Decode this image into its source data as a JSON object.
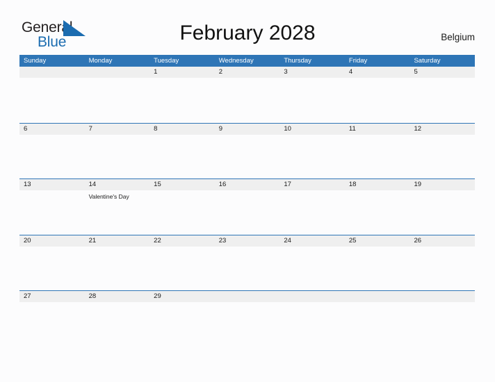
{
  "brand": {
    "name_part1": "General",
    "name_part2": "Blue",
    "flag_icon": "blue-triangle-flag-icon",
    "accent_color": "#1b6cb0"
  },
  "header": {
    "title": "February 2028",
    "country": "Belgium"
  },
  "theme": {
    "header_blue": "#2e75b6",
    "band_gray": "#efefef",
    "page_background": "#fcfcfd",
    "text_color": "#1a1a1a"
  },
  "calendar": {
    "month": "February",
    "year": "2028",
    "weekday_headers": [
      "Sunday",
      "Monday",
      "Tuesday",
      "Wednesday",
      "Thursday",
      "Friday",
      "Saturday"
    ],
    "weeks": [
      [
        {
          "date": "",
          "events": []
        },
        {
          "date": "",
          "events": []
        },
        {
          "date": "1",
          "events": []
        },
        {
          "date": "2",
          "events": []
        },
        {
          "date": "3",
          "events": []
        },
        {
          "date": "4",
          "events": []
        },
        {
          "date": "5",
          "events": []
        }
      ],
      [
        {
          "date": "6",
          "events": []
        },
        {
          "date": "7",
          "events": []
        },
        {
          "date": "8",
          "events": []
        },
        {
          "date": "9",
          "events": []
        },
        {
          "date": "10",
          "events": []
        },
        {
          "date": "11",
          "events": []
        },
        {
          "date": "12",
          "events": []
        }
      ],
      [
        {
          "date": "13",
          "events": []
        },
        {
          "date": "14",
          "events": [
            "Valentine's Day"
          ]
        },
        {
          "date": "15",
          "events": []
        },
        {
          "date": "16",
          "events": []
        },
        {
          "date": "17",
          "events": []
        },
        {
          "date": "18",
          "events": []
        },
        {
          "date": "19",
          "events": []
        }
      ],
      [
        {
          "date": "20",
          "events": []
        },
        {
          "date": "21",
          "events": []
        },
        {
          "date": "22",
          "events": []
        },
        {
          "date": "23",
          "events": []
        },
        {
          "date": "24",
          "events": []
        },
        {
          "date": "25",
          "events": []
        },
        {
          "date": "26",
          "events": []
        }
      ],
      [
        {
          "date": "27",
          "events": []
        },
        {
          "date": "28",
          "events": []
        },
        {
          "date": "29",
          "events": []
        },
        {
          "date": "",
          "events": []
        },
        {
          "date": "",
          "events": []
        },
        {
          "date": "",
          "events": []
        },
        {
          "date": "",
          "events": []
        }
      ]
    ]
  }
}
